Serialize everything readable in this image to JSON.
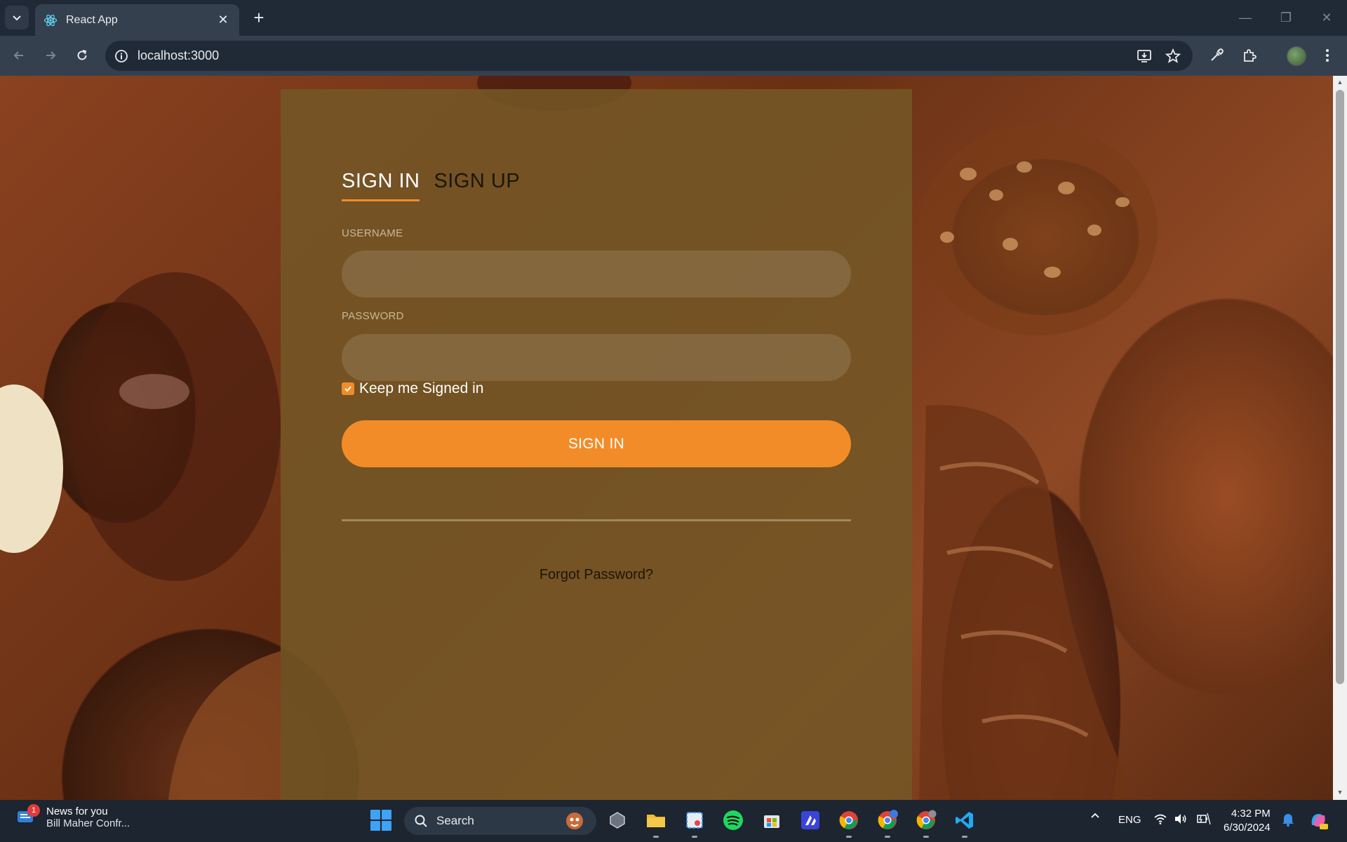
{
  "browser": {
    "tab_title": "React App",
    "url": "localhost:3000"
  },
  "page": {
    "tabs": [
      {
        "label": "SIGN IN",
        "active": true
      },
      {
        "label": "SIGN UP",
        "active": false
      }
    ],
    "username_label": "USERNAME",
    "username_value": "",
    "password_label": "PASSWORD",
    "password_value": "",
    "keep_signed_in_label": "Keep me Signed in",
    "keep_signed_in_checked": true,
    "submit_label": "SIGN IN",
    "forgot_label": "Forgot Password?",
    "accent_color": "#f28c28"
  },
  "taskbar": {
    "news_title": "News for you",
    "news_subtitle": "Bill Maher Confr...",
    "news_badge": "1",
    "search_label": "Search",
    "language": "ENG",
    "time": "4:32 PM",
    "date": "6/30/2024",
    "apps": [
      "task-view-icon",
      "file-explorer-icon",
      "snipping-tool-icon",
      "spotify-icon",
      "microsoft-store-icon",
      "ide-icon",
      "chrome-icon",
      "chrome-profile-icon",
      "chrome-icon",
      "vscode-icon"
    ]
  }
}
